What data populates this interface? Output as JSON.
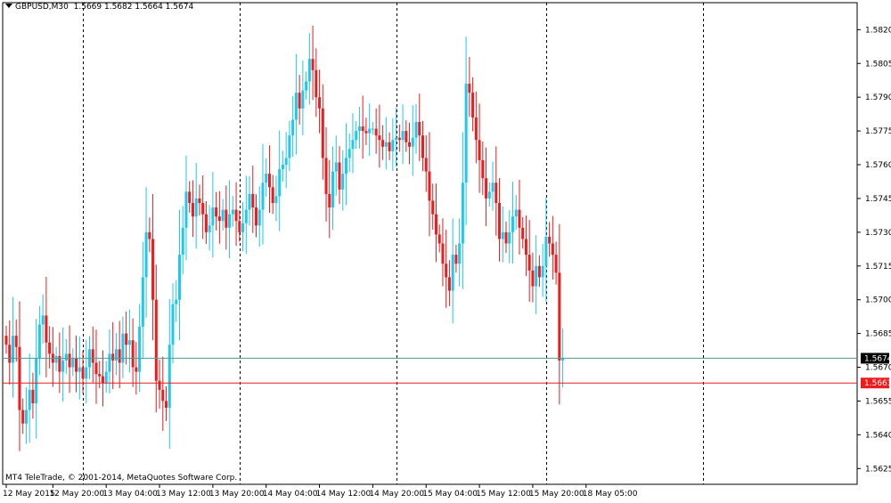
{
  "header": {
    "symbol": "GBPUSD,M30",
    "ohlc": "1.5669 1.5682 1.5664 1.5674"
  },
  "footer": {
    "copyright": "MT4 TeleTrade, © 2001-2014, MetaQuotes Software Corp."
  },
  "colors": {
    "bull": "#1ec8f0",
    "bear": "#ee1c1c",
    "bid_line": "#4a9a9a",
    "ask_line": "#ee1c1c",
    "bid_tag_bg": "#000000",
    "ask_tag_bg": "#ee1c1c",
    "separator": "#000000"
  },
  "chart_data": {
    "type": "candlestick",
    "symbol": "GBPUSD",
    "timeframe": "M30",
    "ylim": [
      1.5618,
      1.5832
    ],
    "y_ticks": [
      "1.5820",
      "1.5805",
      "1.5790",
      "1.5775",
      "1.5760",
      "1.5745",
      "1.5730",
      "1.5715",
      "1.5700",
      "1.5685",
      "1.5670",
      "1.5655",
      "1.5640",
      "1.5625"
    ],
    "bid_price": "1.5674",
    "ask_price": "1.5663",
    "x_tick_labels": [
      "12 May 2015",
      "12 May 20:00",
      "13 May 04:00",
      "13 May 12:00",
      "13 May 20:00",
      "14 May 04:00",
      "14 May 12:00",
      "14 May 20:00",
      "15 May 04:00",
      "15 May 12:00",
      "15 May 20:00",
      "18 May 05:00"
    ],
    "x_tick_bar_index": [
      0,
      14,
      30,
      46,
      62,
      78,
      94,
      110,
      126,
      142,
      158,
      174
    ],
    "day_separator_bar_index": [
      23,
      70,
      117,
      162,
      209
    ],
    "closes": [
      1.568,
      1.5672,
      1.5684,
      1.5679,
      1.5651,
      1.5645,
      1.5651,
      1.566,
      1.5654,
      1.5674,
      1.5689,
      1.5693,
      1.5681,
      1.5676,
      1.5672,
      1.5675,
      1.5668,
      1.5673,
      1.5676,
      1.567,
      1.5674,
      1.5668,
      1.567,
      1.5665,
      1.567,
      1.5678,
      1.5672,
      1.5667,
      1.5666,
      1.5663,
      1.5668,
      1.5676,
      1.5673,
      1.5678,
      1.5672,
      1.5685,
      1.568,
      1.5682,
      1.567,
      1.5668,
      1.5688,
      1.571,
      1.573,
      1.5727,
      1.57,
      1.5664,
      1.566,
      1.5655,
      1.5652,
      1.568,
      1.5698,
      1.57,
      1.572,
      1.5732,
      1.5748,
      1.5743,
      1.5737,
      1.5745,
      1.5743,
      1.5738,
      1.573,
      1.5733,
      1.5741,
      1.5737,
      1.5735,
      1.574,
      1.5732,
      1.5738,
      1.574,
      1.5735,
      1.573,
      1.5734,
      1.574,
      1.5747,
      1.5741,
      1.5733,
      1.574,
      1.5752,
      1.5756,
      1.575,
      1.5743,
      1.5746,
      1.5758,
      1.576,
      1.5763,
      1.5773,
      1.578,
      1.5792,
      1.5785,
      1.5793,
      1.5797,
      1.5807,
      1.5802,
      1.579,
      1.5785,
      1.5763,
      1.5747,
      1.5741,
      1.5757,
      1.5761,
      1.5749,
      1.5756,
      1.5763,
      1.5767,
      1.5771,
      1.5775,
      1.5777,
      1.5775,
      1.5774,
      1.5776,
      1.5776,
      1.5773,
      1.5771,
      1.5768,
      1.577,
      1.5766,
      1.5771,
      1.5772,
      1.5771,
      1.5775,
      1.577,
      1.5768,
      1.5772,
      1.5779,
      1.5773,
      1.5763,
      1.5757,
      1.5744,
      1.5738,
      1.5729,
      1.5725,
      1.5716,
      1.571,
      1.5704,
      1.572,
      1.5716,
      1.5725,
      1.5752,
      1.5796,
      1.5792,
      1.5781,
      1.5771,
      1.5762,
      1.5754,
      1.5745,
      1.5748,
      1.5752,
      1.5743,
      1.5727,
      1.573,
      1.5725,
      1.573,
      1.5737,
      1.574,
      1.5732,
      1.5727,
      1.572,
      1.5713,
      1.5706,
      1.5715,
      1.571,
      1.5715,
      1.5728,
      1.5725,
      1.572,
      1.5712,
      1.5673,
      1.5674
    ]
  }
}
